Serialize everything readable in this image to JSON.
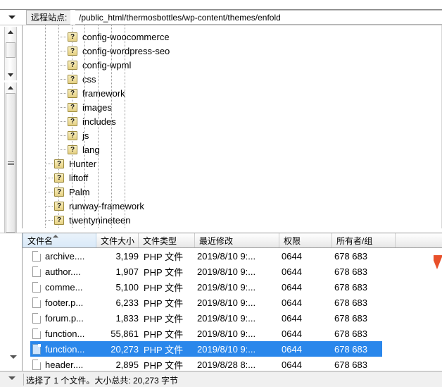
{
  "window": {
    "title": "FileZilla - Remote site panel"
  },
  "toolbar": {
    "dropdown_icon": "chevron-down-icon",
    "site_label": "远程站点:",
    "site_path": "/public_html/thermosbottles/wp-content/themes/enfold"
  },
  "tree": {
    "folder_icon": "?",
    "items": [
      {
        "label": "config-woocommerce",
        "depth": 6
      },
      {
        "label": "config-wordpress-seo",
        "depth": 6
      },
      {
        "label": "config-wpml",
        "depth": 6
      },
      {
        "label": "css",
        "depth": 6
      },
      {
        "label": "framework",
        "depth": 6
      },
      {
        "label": "images",
        "depth": 6
      },
      {
        "label": "includes",
        "depth": 6
      },
      {
        "label": "js",
        "depth": 6
      },
      {
        "label": "lang",
        "depth": 6
      },
      {
        "label": "Hunter",
        "depth": 5
      },
      {
        "label": "liftoff",
        "depth": 5
      },
      {
        "label": "Palm",
        "depth": 5
      },
      {
        "label": "runway-framework",
        "depth": 5
      },
      {
        "label": "twentynineteen",
        "depth": 5
      }
    ]
  },
  "filelist": {
    "columns": [
      {
        "key": "name",
        "label": "文件名",
        "sorted": true,
        "sort_dir": "asc"
      },
      {
        "key": "size",
        "label": "文件大小",
        "sorted": false,
        "sort_dir": ""
      },
      {
        "key": "type",
        "label": "文件类型",
        "sorted": false,
        "sort_dir": ""
      },
      {
        "key": "mtime",
        "label": "最近修改",
        "sorted": false,
        "sort_dir": ""
      },
      {
        "key": "perm",
        "label": "权限",
        "sorted": false,
        "sort_dir": ""
      },
      {
        "key": "owner",
        "label": "所有者/组",
        "sorted": false,
        "sort_dir": ""
      }
    ],
    "rows": [
      {
        "name": "archive....",
        "size": "3,199",
        "type": "PHP 文件",
        "mtime": "2019/8/10 9:...",
        "perm": "0644",
        "owner": "678 683",
        "selected": false
      },
      {
        "name": "author....",
        "size": "1,907",
        "type": "PHP 文件",
        "mtime": "2019/8/10 9:...",
        "perm": "0644",
        "owner": "678 683",
        "selected": false
      },
      {
        "name": "comme...",
        "size": "5,100",
        "type": "PHP 文件",
        "mtime": "2019/8/10 9:...",
        "perm": "0644",
        "owner": "678 683",
        "selected": false
      },
      {
        "name": "footer.p...",
        "size": "6,233",
        "type": "PHP 文件",
        "mtime": "2019/8/10 9:...",
        "perm": "0644",
        "owner": "678 683",
        "selected": false
      },
      {
        "name": "forum.p...",
        "size": "1,833",
        "type": "PHP 文件",
        "mtime": "2019/8/10 9:...",
        "perm": "0644",
        "owner": "678 683",
        "selected": false
      },
      {
        "name": "function...",
        "size": "55,861",
        "type": "PHP 文件",
        "mtime": "2019/8/10 9:...",
        "perm": "0644",
        "owner": "678 683",
        "selected": false
      },
      {
        "name": "function...",
        "size": "20,273",
        "type": "PHP 文件",
        "mtime": "2019/8/10 9:...",
        "perm": "0644",
        "owner": "678 683",
        "selected": true
      },
      {
        "name": "header....",
        "size": "2,895",
        "type": "PHP 文件",
        "mtime": "2019/8/28 8:...",
        "perm": "0644",
        "owner": "678 683",
        "selected": false
      }
    ]
  },
  "statusbar": {
    "text": "选择了 1 个文件。大小总共: 20,273 字节"
  },
  "colors": {
    "selection": "#2a87eb",
    "sorted_header": "#d9e9f8",
    "folder_icon": "#efdf9d",
    "cursor": "#e8502a"
  }
}
